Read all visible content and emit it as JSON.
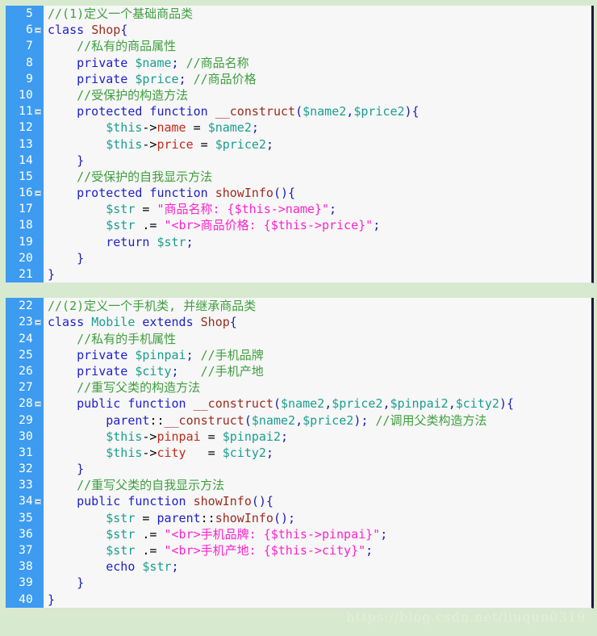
{
  "editor": {
    "language": "PHP",
    "colors": {
      "page_background": "#d7e9cf",
      "code_background": "#f7f7f7",
      "gutter_background": "#3d9bf0",
      "gutter_text": "#ffffff",
      "comment": "#3f9f3f",
      "keyword": "#2020cc",
      "variable": "#1a9e8f",
      "function": "#9c2b1e",
      "string": "#ff22cc",
      "property": "#c02a1a",
      "border": "#211638"
    }
  },
  "watermark": "https://blog.csdn.net/liuqun0319",
  "blocks": [
    {
      "id": "block-1",
      "lines": [
        {
          "number": "5",
          "fold": false,
          "tokens": [
            {
              "c": "t-com",
              "t": "//(1)定义一个基础商品类"
            }
          ],
          "plain": "//(1)定义一个基础商品类"
        },
        {
          "number": "6",
          "fold": true,
          "tokens": [
            {
              "c": "t-kw",
              "t": "class"
            },
            {
              "c": "t-op",
              "t": " "
            },
            {
              "c": "t-fn",
              "t": "Shop"
            },
            {
              "c": "t-pun",
              "t": "{"
            }
          ],
          "plain": "class Shop{"
        },
        {
          "number": "7",
          "fold": false,
          "tokens": [
            {
              "c": "t-com",
              "t": "    //私有的商品属性"
            }
          ],
          "plain": "    //私有的商品属性"
        },
        {
          "number": "8",
          "fold": false,
          "tokens": [
            {
              "c": "t-kw",
              "t": "    private"
            },
            {
              "c": "t-op",
              "t": " "
            },
            {
              "c": "t-var",
              "t": "$name"
            },
            {
              "c": "t-pun",
              "t": ";"
            },
            {
              "c": "t-op",
              "t": " "
            },
            {
              "c": "t-com",
              "t": "//商品名称"
            }
          ],
          "plain": "    private $name; //商品名称"
        },
        {
          "number": "9",
          "fold": false,
          "tokens": [
            {
              "c": "t-kw",
              "t": "    private"
            },
            {
              "c": "t-op",
              "t": " "
            },
            {
              "c": "t-var",
              "t": "$price"
            },
            {
              "c": "t-pun",
              "t": ";"
            },
            {
              "c": "t-op",
              "t": " "
            },
            {
              "c": "t-com",
              "t": "//商品价格"
            }
          ],
          "plain": "    private $price; //商品价格"
        },
        {
          "number": "10",
          "fold": false,
          "tokens": [
            {
              "c": "t-com",
              "t": "    //受保护的构造方法"
            }
          ],
          "plain": "    //受保护的构造方法"
        },
        {
          "number": "11",
          "fold": true,
          "tokens": [
            {
              "c": "t-kw",
              "t": "    protected function"
            },
            {
              "c": "t-op",
              "t": " "
            },
            {
              "c": "t-fn",
              "t": "__construct"
            },
            {
              "c": "t-pun",
              "t": "("
            },
            {
              "c": "t-var",
              "t": "$name2"
            },
            {
              "c": "t-pun",
              "t": ","
            },
            {
              "c": "t-var",
              "t": "$price2"
            },
            {
              "c": "t-pun",
              "t": "){"
            }
          ],
          "plain": "    protected function __construct($name2,$price2){"
        },
        {
          "number": "12",
          "fold": false,
          "tokens": [
            {
              "c": "t-var",
              "t": "        $this"
            },
            {
              "c": "t-op",
              "t": "->"
            },
            {
              "c": "t-prop",
              "t": "name"
            },
            {
              "c": "t-op",
              "t": " = "
            },
            {
              "c": "t-var",
              "t": "$name2"
            },
            {
              "c": "t-pun",
              "t": ";"
            }
          ],
          "plain": "        $this->name = $name2;"
        },
        {
          "number": "13",
          "fold": false,
          "tokens": [
            {
              "c": "t-var",
              "t": "        $this"
            },
            {
              "c": "t-op",
              "t": "->"
            },
            {
              "c": "t-prop",
              "t": "price"
            },
            {
              "c": "t-op",
              "t": " = "
            },
            {
              "c": "t-var",
              "t": "$price2"
            },
            {
              "c": "t-pun",
              "t": ";"
            }
          ],
          "plain": "        $this->price = $price2;"
        },
        {
          "number": "14",
          "fold": false,
          "tokens": [
            {
              "c": "t-pun",
              "t": "    }"
            }
          ],
          "plain": "    }"
        },
        {
          "number": "15",
          "fold": false,
          "tokens": [
            {
              "c": "t-com",
              "t": "    //受保护的自我显示方法"
            }
          ],
          "plain": "    //受保护的自我显示方法"
        },
        {
          "number": "16",
          "fold": true,
          "tokens": [
            {
              "c": "t-kw",
              "t": "    protected function"
            },
            {
              "c": "t-op",
              "t": " "
            },
            {
              "c": "t-fn",
              "t": "showInfo"
            },
            {
              "c": "t-pun",
              "t": "(){"
            }
          ],
          "plain": "    protected function showInfo(){"
        },
        {
          "number": "17",
          "fold": false,
          "tokens": [
            {
              "c": "t-var",
              "t": "        $str"
            },
            {
              "c": "t-op",
              "t": " = "
            },
            {
              "c": "t-str",
              "t": "\"商品名称: {$this->name}\""
            },
            {
              "c": "t-pun",
              "t": ";"
            }
          ],
          "plain": "        $str = \"商品名称: {$this->name}\";"
        },
        {
          "number": "18",
          "fold": false,
          "tokens": [
            {
              "c": "t-var",
              "t": "        $str"
            },
            {
              "c": "t-op",
              "t": " .= "
            },
            {
              "c": "t-str",
              "t": "\"<br>商品价格: {$this->price}\""
            },
            {
              "c": "t-pun",
              "t": ";"
            }
          ],
          "plain": "        $str .= \"<br>商品价格: {$this->price}\";"
        },
        {
          "number": "19",
          "fold": false,
          "tokens": [
            {
              "c": "t-kw",
              "t": "        return"
            },
            {
              "c": "t-op",
              "t": " "
            },
            {
              "c": "t-var",
              "t": "$str"
            },
            {
              "c": "t-pun",
              "t": ";"
            }
          ],
          "plain": "        return $str;"
        },
        {
          "number": "20",
          "fold": false,
          "tokens": [
            {
              "c": "t-pun",
              "t": "    }"
            }
          ],
          "plain": "    }"
        },
        {
          "number": "21",
          "fold": false,
          "tokens": [
            {
              "c": "t-pun",
              "t": "}"
            }
          ],
          "plain": "}"
        }
      ]
    },
    {
      "id": "block-2",
      "lines": [
        {
          "number": "22",
          "fold": false,
          "tokens": [
            {
              "c": "t-com",
              "t": "//(2)定义一个手机类, 并继承商品类"
            }
          ],
          "plain": "//(2)定义一个手机类, 并继承商品类"
        },
        {
          "number": "23",
          "fold": true,
          "tokens": [
            {
              "c": "t-kw",
              "t": "class"
            },
            {
              "c": "t-op",
              "t": " "
            },
            {
              "c": "t-var",
              "t": "Mobile"
            },
            {
              "c": "t-op",
              "t": " "
            },
            {
              "c": "t-kw",
              "t": "extends"
            },
            {
              "c": "t-op",
              "t": " "
            },
            {
              "c": "t-fn",
              "t": "Shop"
            },
            {
              "c": "t-pun",
              "t": "{"
            }
          ],
          "plain": "class Mobile extends Shop{"
        },
        {
          "number": "24",
          "fold": false,
          "tokens": [
            {
              "c": "t-com",
              "t": "    //私有的手机属性"
            }
          ],
          "plain": "    //私有的手机属性"
        },
        {
          "number": "25",
          "fold": false,
          "tokens": [
            {
              "c": "t-kw",
              "t": "    private"
            },
            {
              "c": "t-op",
              "t": " "
            },
            {
              "c": "t-var",
              "t": "$pinpai"
            },
            {
              "c": "t-pun",
              "t": ";"
            },
            {
              "c": "t-op",
              "t": " "
            },
            {
              "c": "t-com",
              "t": "//手机品牌"
            }
          ],
          "plain": "    private $pinpai; //手机品牌"
        },
        {
          "number": "26",
          "fold": false,
          "tokens": [
            {
              "c": "t-kw",
              "t": "    private"
            },
            {
              "c": "t-op",
              "t": " "
            },
            {
              "c": "t-var",
              "t": "$city"
            },
            {
              "c": "t-pun",
              "t": ";"
            },
            {
              "c": "t-op",
              "t": "   "
            },
            {
              "c": "t-com",
              "t": "//手机产地"
            }
          ],
          "plain": "    private $city;   //手机产地"
        },
        {
          "number": "27",
          "fold": false,
          "tokens": [
            {
              "c": "t-com",
              "t": "    //重写父类的构造方法"
            }
          ],
          "plain": "    //重写父类的构造方法"
        },
        {
          "number": "28",
          "fold": true,
          "tokens": [
            {
              "c": "t-kw",
              "t": "    public function"
            },
            {
              "c": "t-op",
              "t": " "
            },
            {
              "c": "t-fn",
              "t": "__construct"
            },
            {
              "c": "t-pun",
              "t": "("
            },
            {
              "c": "t-var",
              "t": "$name2"
            },
            {
              "c": "t-pun",
              "t": ","
            },
            {
              "c": "t-var",
              "t": "$price2"
            },
            {
              "c": "t-pun",
              "t": ","
            },
            {
              "c": "t-var",
              "t": "$pinpai2"
            },
            {
              "c": "t-pun",
              "t": ","
            },
            {
              "c": "t-var",
              "t": "$city2"
            },
            {
              "c": "t-pun",
              "t": "){"
            }
          ],
          "plain": "    public function __construct($name2,$price2,$pinpai2,$city2){"
        },
        {
          "number": "29",
          "fold": false,
          "tokens": [
            {
              "c": "t-kw",
              "t": "        parent"
            },
            {
              "c": "t-op",
              "t": "::"
            },
            {
              "c": "t-fn",
              "t": "__construct"
            },
            {
              "c": "t-pun",
              "t": "("
            },
            {
              "c": "t-var",
              "t": "$name2"
            },
            {
              "c": "t-pun",
              "t": ","
            },
            {
              "c": "t-var",
              "t": "$price2"
            },
            {
              "c": "t-pun",
              "t": ");"
            },
            {
              "c": "t-op",
              "t": " "
            },
            {
              "c": "t-com",
              "t": "//调用父类构造方法"
            }
          ],
          "plain": "        parent::__construct($name2,$price2); //调用父类构造方法"
        },
        {
          "number": "30",
          "fold": false,
          "tokens": [
            {
              "c": "t-var",
              "t": "        $this"
            },
            {
              "c": "t-op",
              "t": "->"
            },
            {
              "c": "t-prop",
              "t": "pinpai"
            },
            {
              "c": "t-op",
              "t": " = "
            },
            {
              "c": "t-var",
              "t": "$pinpai2"
            },
            {
              "c": "t-pun",
              "t": ";"
            }
          ],
          "plain": "        $this->pinpai = $pinpai2;"
        },
        {
          "number": "31",
          "fold": false,
          "tokens": [
            {
              "c": "t-var",
              "t": "        $this"
            },
            {
              "c": "t-op",
              "t": "->"
            },
            {
              "c": "t-prop",
              "t": "city"
            },
            {
              "c": "t-op",
              "t": "   = "
            },
            {
              "c": "t-var",
              "t": "$city2"
            },
            {
              "c": "t-pun",
              "t": ";"
            }
          ],
          "plain": "        $this->city   = $city2;"
        },
        {
          "number": "32",
          "fold": false,
          "tokens": [
            {
              "c": "t-pun",
              "t": "    }"
            }
          ],
          "plain": "    }"
        },
        {
          "number": "33",
          "fold": false,
          "tokens": [
            {
              "c": "t-com",
              "t": "    //重写父类的自我显示方法"
            }
          ],
          "plain": "    //重写父类的自我显示方法"
        },
        {
          "number": "34",
          "fold": true,
          "tokens": [
            {
              "c": "t-kw",
              "t": "    public function"
            },
            {
              "c": "t-op",
              "t": " "
            },
            {
              "c": "t-fn",
              "t": "showInfo"
            },
            {
              "c": "t-pun",
              "t": "(){"
            }
          ],
          "plain": "    public function showInfo(){"
        },
        {
          "number": "35",
          "fold": false,
          "tokens": [
            {
              "c": "t-var",
              "t": "        $str"
            },
            {
              "c": "t-op",
              "t": " = "
            },
            {
              "c": "t-kw",
              "t": "parent"
            },
            {
              "c": "t-op",
              "t": "::"
            },
            {
              "c": "t-fn",
              "t": "showInfo"
            },
            {
              "c": "t-pun",
              "t": "();"
            }
          ],
          "plain": "        $str = parent::showInfo();"
        },
        {
          "number": "36",
          "fold": false,
          "tokens": [
            {
              "c": "t-var",
              "t": "        $str"
            },
            {
              "c": "t-op",
              "t": " .= "
            },
            {
              "c": "t-str",
              "t": "\"<br>手机品牌: {$this->pinpai}\""
            },
            {
              "c": "t-pun",
              "t": ";"
            }
          ],
          "plain": "        $str .= \"<br>手机品牌: {$this->pinpai}\";"
        },
        {
          "number": "37",
          "fold": false,
          "tokens": [
            {
              "c": "t-var",
              "t": "        $str"
            },
            {
              "c": "t-op",
              "t": " .= "
            },
            {
              "c": "t-str",
              "t": "\"<br>手机产地: {$this->city}\""
            },
            {
              "c": "t-pun",
              "t": ";"
            }
          ],
          "plain": "        $str .= \"<br>手机产地: {$this->city}\";"
        },
        {
          "number": "38",
          "fold": false,
          "tokens": [
            {
              "c": "t-kw",
              "t": "        echo"
            },
            {
              "c": "t-op",
              "t": " "
            },
            {
              "c": "t-var",
              "t": "$str"
            },
            {
              "c": "t-pun",
              "t": ";"
            }
          ],
          "plain": "        echo $str;"
        },
        {
          "number": "39",
          "fold": false,
          "tokens": [
            {
              "c": "t-pun",
              "t": "    }"
            }
          ],
          "plain": "    }"
        },
        {
          "number": "40",
          "fold": false,
          "tokens": [
            {
              "c": "t-pun",
              "t": "}"
            }
          ],
          "plain": "}"
        }
      ]
    }
  ]
}
